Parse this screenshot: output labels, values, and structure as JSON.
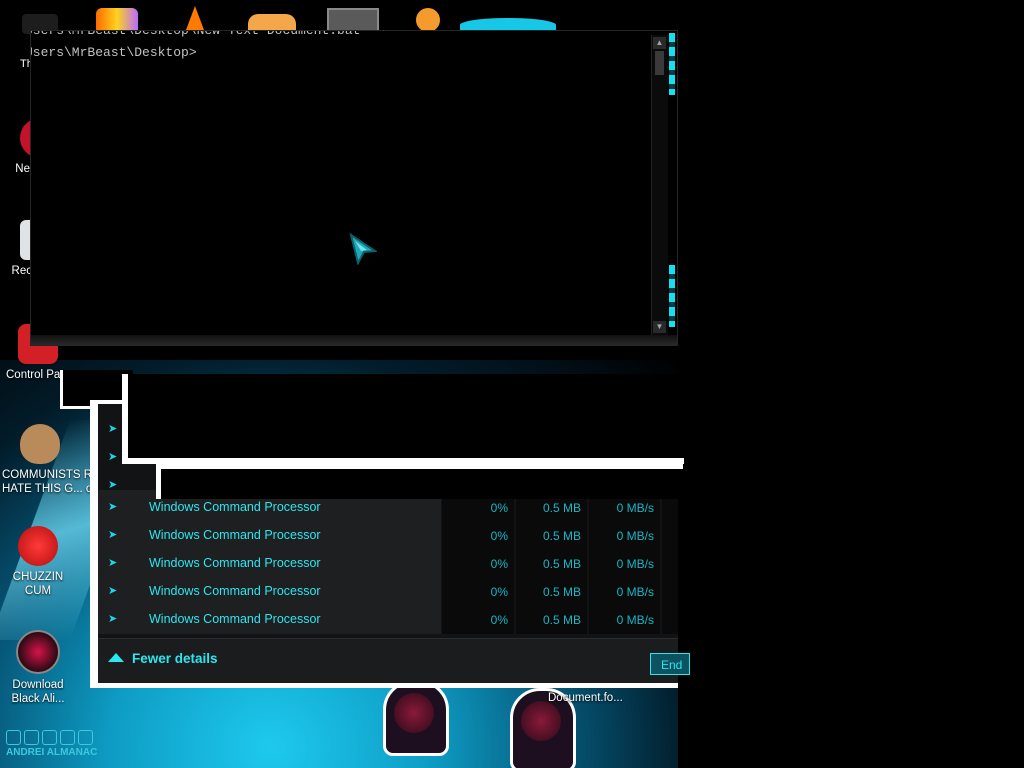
{
  "desktop": {
    "top_icons": [
      {
        "icon": "hat-icon",
        "label": "Th"
      },
      {
        "icon": "folder-fire-icon",
        "label": ""
      },
      {
        "icon": "vlc-cone-icon",
        "label": ""
      },
      {
        "icon": "blender-icon",
        "label": ""
      },
      {
        "icon": "screen-icon",
        "label": ""
      },
      {
        "icon": "orange-avatar-icon",
        "label": ""
      }
    ],
    "icons": [
      {
        "icon": "red-app-icon",
        "label": "Ne"
      },
      {
        "icon": "recycle-bin-icon",
        "label": "Rec"
      },
      {
        "icon": "control-panel-icon",
        "label": "Control Pa"
      },
      {
        "icon": "money-bag-icon",
        "label": "COMMUNISTS R\nHATE THIS G... o"
      },
      {
        "icon": "red-monster-icon",
        "label": "CHUZZIN\nCUM"
      },
      {
        "icon": "black-alien-icon",
        "label": "Download\nBlack Ali..."
      }
    ],
    "document_label": "Document.fo...",
    "brand": "ANDREI ALMANAC"
  },
  "cmd": {
    "lines": [
      "Users\\MrBeast\\Desktop\\New Text Document.bat",
      "Users\\MrBeast\\Desktop>"
    ],
    "scroll_up": "▲",
    "scroll_down": "▼"
  },
  "task_manager": {
    "rows": [
      {
        "name": "Windows Command Processor",
        "cpu": "0%",
        "memory": "0.5 MB",
        "disk": "0 MB/s"
      },
      {
        "name": "Windows Command Processor",
        "cpu": "0%",
        "memory": "0.5 MB",
        "disk": "0 MB/s"
      },
      {
        "name": "Windows Command Processor",
        "cpu": "0%",
        "memory": "0.5 MB",
        "disk": "0 MB/s"
      },
      {
        "name": "Windows Command Processor",
        "cpu": "0%",
        "memory": "0.5 MB",
        "disk": "0 MB/s"
      },
      {
        "name": "Windows Command Processor",
        "cpu": "0%",
        "memory": "0.5 MB",
        "disk": "0 MB/s"
      }
    ],
    "row_arrow": "➤",
    "fewer_details": "Fewer details",
    "end_task": "End task"
  },
  "colors": {
    "accent": "#2ce6f0",
    "value": "#16b7c7"
  }
}
